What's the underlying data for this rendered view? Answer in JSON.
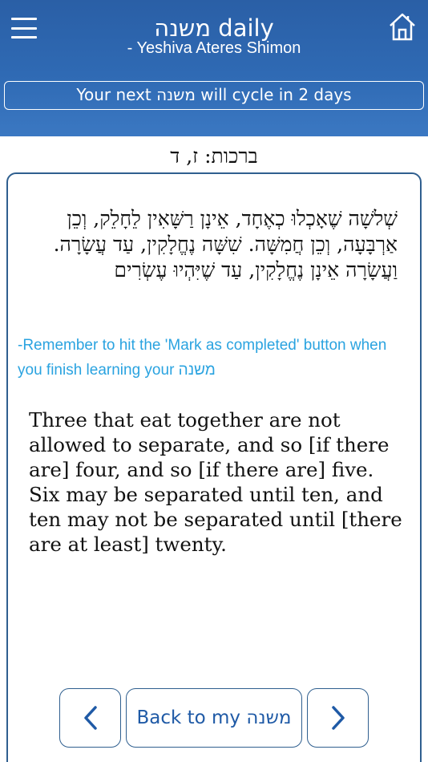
{
  "header": {
    "title": "משנה daily",
    "subtitle": "- Yeshiva Ateres Shimon",
    "menu_icon": "hamburger-menu-icon",
    "home_icon": "home-icon"
  },
  "cycle_banner": "Your next משנה will cycle in 2 days",
  "mishna": {
    "reference": "ברכות: ז, ד",
    "hebrew": "שְׁלשָׁה שֶׁאָכְלוּ כְאֶחָד, אֵינָן רַשָּׁאִין לֵחָלֵק, וְכֵן אַרְבָּעָה, וְכֵן חֲמִשָּׁה. שִׁשָּׁה נֶחֱלָקִין, עַד עֲשָׂרָה. וַעֲשָׂרָה אֵינָן נֶחֱלָקִין, עַד שֶׁיִּהְיוּ עֶשְׂרִים",
    "reminder": "-Remember to hit the 'Mark as completed' button when you finish learning your משנה",
    "translation": "Three that eat together are not allowed to separate, and so [if there are] four, and so [if there are] five. Six may be separated until ten, and ten may not be separated until [there are at least] twenty."
  },
  "nav": {
    "back_label": "Back to my משנה",
    "prev_icon": "chevron-left-icon",
    "next_icon": "chevron-right-icon"
  },
  "colors": {
    "header_bg": "#2f6ab4",
    "accent": "#1f5aa6",
    "reminder": "#2aa3e0",
    "card_border": "#2f5f8f"
  }
}
